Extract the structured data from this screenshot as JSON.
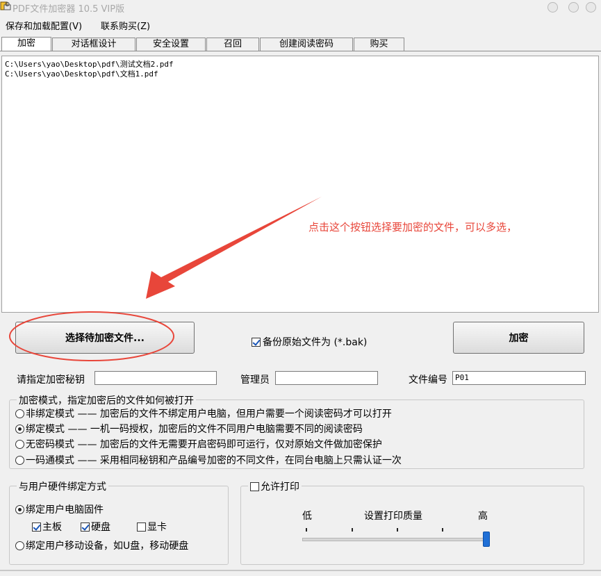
{
  "window": {
    "title": "PDF文件加密器 10.5 VIP版"
  },
  "menu": {
    "items": [
      {
        "label": "保存和加载配置(V)"
      },
      {
        "label": "联系购买(Z)"
      }
    ]
  },
  "tabs": [
    {
      "label": "加密",
      "active": true
    },
    {
      "label": "对话框设计"
    },
    {
      "label": "安全设置"
    },
    {
      "label": "召回"
    },
    {
      "label": "创建阅读密码"
    },
    {
      "label": "购买"
    }
  ],
  "file_list": {
    "files": [
      "C:\\Users\\yao\\Desktop\\pdf\\测试文档2.pdf",
      "C:\\Users\\yao\\Desktop\\pdf\\文档1.pdf"
    ]
  },
  "annotation": {
    "text": "点击这个按钮选择要加密的文件，可以多选，",
    "color": "#e8463a"
  },
  "actions": {
    "select_files_label": "选择待加密文件...",
    "backup_label": "备份原始文件为 (*.bak)",
    "backup_checked": true,
    "encrypt_label": "加密"
  },
  "fields": {
    "secret_key_label": "请指定加密秘钥",
    "secret_key_value": "",
    "admin_label": "管理员",
    "admin_value": "",
    "file_id_label": "文件编号",
    "file_id_value": "P01"
  },
  "encryption_mode": {
    "title": "加密模式，指定加密后的文件如何被打开",
    "options": [
      {
        "label": "非绑定模式 —— 加密后的文件不绑定用户电脑，但用户需要一个阅读密码才可以打开",
        "checked": false
      },
      {
        "label": "绑定模式 —— 一机一码授权，加密后的文件不同用户电脑需要不同的阅读密码",
        "checked": true
      },
      {
        "label": "无密码模式 —— 加密后的文件无需要开启密码即可运行，仅对原始文件做加密保护",
        "checked": false
      },
      {
        "label": "一码通模式 —— 采用相同秘钥和产品编号加密的不同文件，在同台电脑上只需认证一次",
        "checked": false
      }
    ]
  },
  "hardware_binding": {
    "title": "与用户硬件绑定方式",
    "bind_firmware_label": "绑定用户电脑固件",
    "bind_firmware_checked": true,
    "components": [
      {
        "label": "主板",
        "checked": true
      },
      {
        "label": "硬盘",
        "checked": true
      },
      {
        "label": "显卡",
        "checked": false
      }
    ],
    "bind_mobile_label": "绑定用户移动设备，如U盘，移动硬盘",
    "bind_mobile_checked": false
  },
  "print": {
    "allow_label": "允许打印",
    "allow_checked": false,
    "low_label": "低",
    "quality_label": "设置打印质量",
    "high_label": "高",
    "quality_level": 1.0
  }
}
